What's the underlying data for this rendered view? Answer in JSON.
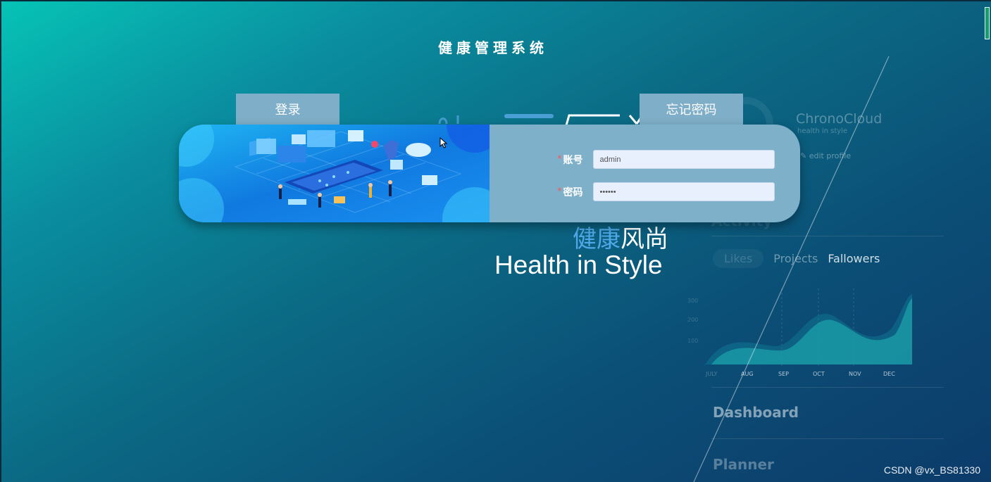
{
  "app": {
    "title": "健康管理系统"
  },
  "tabs": {
    "login": "登录",
    "forgot": "忘记密码"
  },
  "form": {
    "required_mark": "*",
    "account_label": "账号",
    "account_value": "admin",
    "password_label": "密码",
    "password_value": "123456"
  },
  "slogan": {
    "cn_highlight": "健康",
    "cn_rest": "风尚",
    "en": "Health in Style"
  },
  "background_dashboard": {
    "brand": "ChronoCloud",
    "brand_sub": "health in style",
    "edit_profile": "edit profile",
    "tabs": [
      "Likes",
      "Projects",
      "Fallowers"
    ],
    "months": [
      "JULY",
      "AUG",
      "SEP",
      "OCT",
      "NOV",
      "DEC"
    ],
    "y_ticks": [
      "300",
      "200",
      "100"
    ],
    "sections": [
      "Dashboard",
      "Planner"
    ]
  },
  "watermark": "CSDN @vx_BS81330",
  "colors": {
    "tab_bg": "#7eaec8",
    "form_bg": "#7eb0c9",
    "required": "#f45b5b",
    "input_bg": "#e8f0fe"
  }
}
